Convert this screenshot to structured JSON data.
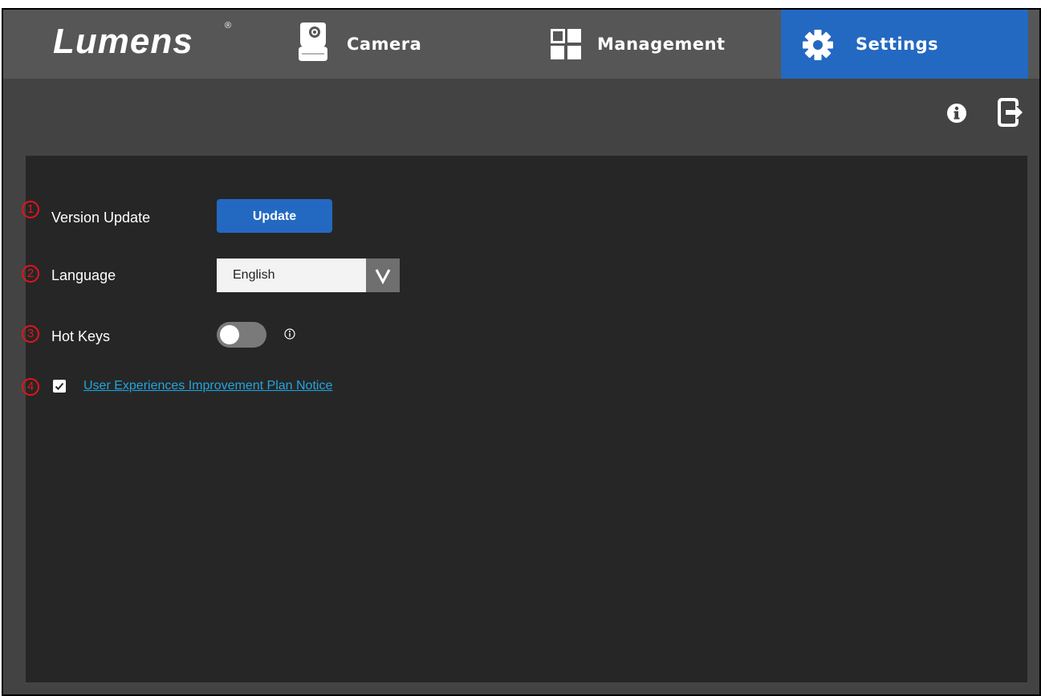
{
  "header": {
    "logo_text": "Lumens",
    "logo_mark": "®",
    "tabs": [
      {
        "label": "Camera",
        "icon": "camera-icon",
        "active": false
      },
      {
        "label": "Management",
        "icon": "grid-icon",
        "active": false
      },
      {
        "label": "Settings",
        "icon": "gear-icon",
        "active": true
      }
    ]
  },
  "toolbar": {
    "info_icon": "info-icon",
    "logout_icon": "logout-icon"
  },
  "settings": {
    "version_update": {
      "marker": "1",
      "label": "Version Update",
      "button_label": "Update"
    },
    "language": {
      "marker": "2",
      "label": "Language",
      "selected": "English",
      "arrow_glyph": "V"
    },
    "hot_keys": {
      "marker": "3",
      "label": "Hot Keys",
      "enabled": false,
      "info_glyph": "ⓘ"
    },
    "uxip": {
      "marker": "4",
      "checked": true,
      "link_text": "User Experiences Improvement Plan Notice"
    }
  },
  "colors": {
    "accent": "#2369c1",
    "nav_bar": "#565656",
    "background": "#434343",
    "panel": "#262626",
    "link": "#1fa6e0",
    "marker": "#e0151b"
  }
}
